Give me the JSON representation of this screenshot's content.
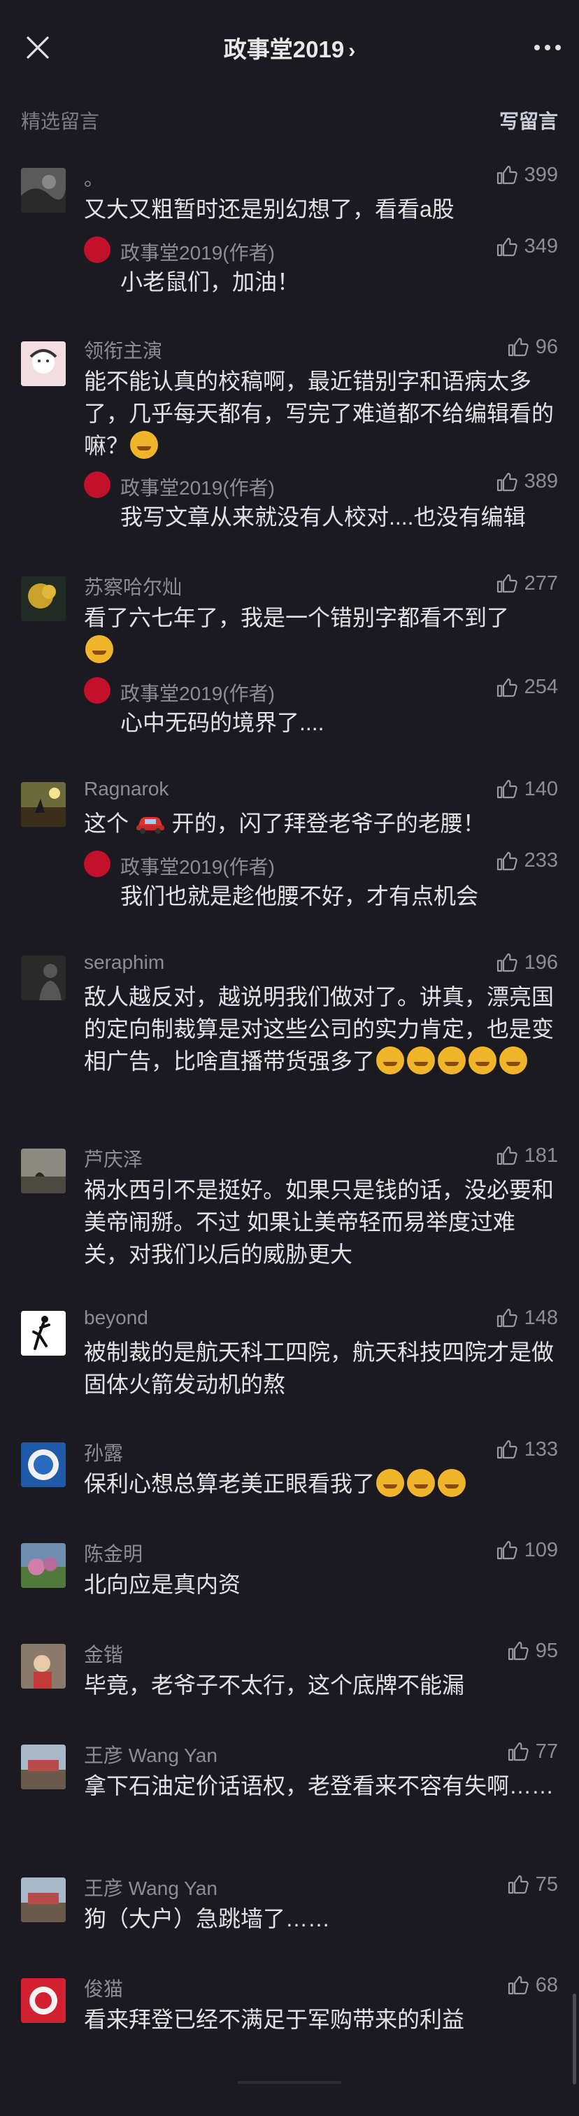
{
  "header": {
    "title": "政事堂2019",
    "title_chevron": "›",
    "close_icon": "close-icon",
    "more_icon": "more-dots-icon"
  },
  "subheader": {
    "section_label": "精选留言",
    "write_label": "写留言"
  },
  "comments": [
    {
      "name": "。",
      "likes": "399",
      "text": "又大又粗暂时还是别幻想了，看看a股",
      "reply": {
        "name": "政事堂2019(作者)",
        "likes": "349",
        "text": "小老鼠们，加油！"
      }
    },
    {
      "name": "领衔主演",
      "likes": "96",
      "text": "能不能认真的校稿啊，最近错别字和语病太多了，几乎每天都有，写完了难道都不给编辑看的嘛？",
      "reply": {
        "name": "政事堂2019(作者)",
        "likes": "389",
        "text": "我写文章从来就没有人校对....也没有编辑"
      }
    },
    {
      "name": "苏察哈尔灿",
      "likes": "277",
      "text": "看了六七年了，我是一个错别字都看不到了",
      "reply": {
        "name": "政事堂2019(作者)",
        "likes": "254",
        "text": "心中无码的境界了...."
      }
    },
    {
      "name": "Ragnarok",
      "likes": "140",
      "text_before": "这个",
      "text_after": "开的，闪了拜登老爷子的老腰！",
      "reply": {
        "name": "政事堂2019(作者)",
        "likes": "233",
        "text": "我们也就是趁他腰不好，才有点机会"
      }
    },
    {
      "name": "seraphim",
      "likes": "196",
      "text": "敌人越反对，越说明我们做对了。讲真，漂亮国的定向制裁算是对这些公司的实力肯定，也是变相广告，比啥直播带货强多了"
    },
    {
      "name": "芦庆泽",
      "likes": "181",
      "text": "祸水西引不是挺好。如果只是钱的话，没必要和美帝闹掰。不过 如果让美帝轻而易举度过难关，对我们以后的威胁更大"
    },
    {
      "name": "beyond",
      "likes": "148",
      "text": "被制裁的是航天科工四院，航天科技四院才是做固体火箭发动机的熬"
    },
    {
      "name": "孙露",
      "likes": "133",
      "text": "保利心想总算老美正眼看我了"
    },
    {
      "name": "陈金明",
      "likes": "109",
      "text": "北向应是真内资"
    },
    {
      "name": "金锴",
      "likes": "95",
      "text": "毕竟，老爷子不太行，这个底牌不能漏"
    },
    {
      "name": "王彦 Wang Yan",
      "likes": "77",
      "text": "拿下石油定价话语权，老登看来不容有失啊……"
    },
    {
      "name": "王彦 Wang Yan",
      "likes": "75",
      "text": "狗（大户）急跳墙了……"
    },
    {
      "name": "俊猫",
      "likes": "68",
      "text": "看来拜登已经不满足于军购带来的利益"
    }
  ],
  "colors": {
    "background": "#1b1a21",
    "text_primary": "#e2e2e6",
    "text_secondary": "#8c8c94",
    "author_badge": "#c2102a"
  },
  "icons": [
    "thumbs-up-icon",
    "emoji-face-icon",
    "car-emoji-icon"
  ]
}
